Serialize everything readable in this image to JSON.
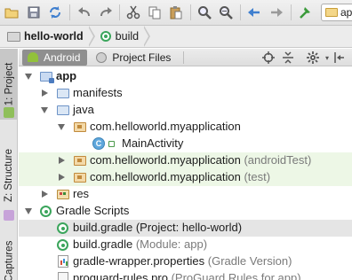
{
  "toolbar": {
    "run_config_label": "ap",
    "buttons": [
      "open-folder-icon",
      "save-icon",
      "sync-icon",
      "undo-icon",
      "redo-icon",
      "cut-icon",
      "copy-icon",
      "paste-icon",
      "find-icon",
      "replace-icon",
      "back-icon",
      "forward-icon",
      "build-hammer-icon"
    ]
  },
  "breadcrumb": {
    "items": [
      {
        "label": "hello-world",
        "icon": "folder-icon"
      },
      {
        "label": "build",
        "icon": "gradle-icon"
      }
    ]
  },
  "left_strip": {
    "tabs": [
      "1: Project",
      "Z: Structure",
      "Captures"
    ]
  },
  "panel": {
    "tabs": [
      {
        "label": "Android",
        "active": true
      },
      {
        "label": "Project Files",
        "active": false
      }
    ]
  },
  "tree": {
    "app": "app",
    "manifests": "manifests",
    "java": "java",
    "pkg_main": "com.helloworld.myapplication",
    "main_activity": "MainActivity",
    "pkg_android_test": "com.helloworld.myapplication",
    "pkg_android_test_hint": "(androidTest)",
    "pkg_test": "com.helloworld.myapplication",
    "pkg_test_hint": "(test)",
    "res": "res",
    "gradle_scripts": "Gradle Scripts",
    "build_gradle_project": "build.gradle",
    "build_gradle_project_hint": "(Project: hello-world)",
    "build_gradle_module": "build.gradle",
    "build_gradle_module_hint": "(Module: app)",
    "gradle_wrapper": "gradle-wrapper.properties",
    "gradle_wrapper_hint": "(Gradle Version)",
    "proguard": "proguard-rules.pro",
    "proguard_hint": "(ProGuard Rules for app)"
  }
}
